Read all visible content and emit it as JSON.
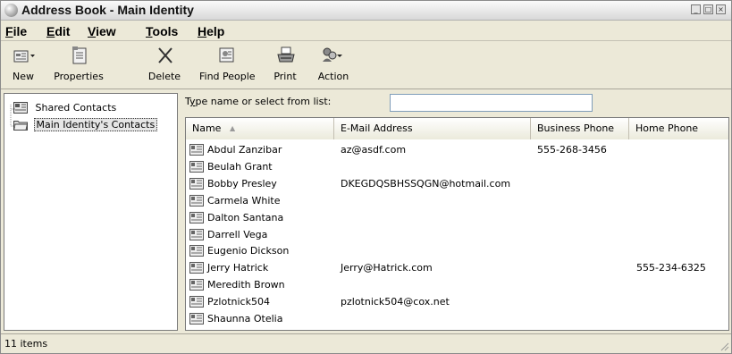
{
  "window": {
    "title": "Address Book - Main Identity"
  },
  "menu": [
    "File",
    "Edit",
    "View",
    "Tools",
    "Help"
  ],
  "toolbar": {
    "new": "New",
    "properties": "Properties",
    "delete": "Delete",
    "find_people": "Find People",
    "print": "Print",
    "action": "Action"
  },
  "tree": {
    "shared": "Shared Contacts",
    "main": "Main Identity's Contacts"
  },
  "search": {
    "label": "Type name or select from list:",
    "value": ""
  },
  "columns": {
    "name": "Name",
    "email": "E-Mail Address",
    "business_phone": "Business Phone",
    "home_phone": "Home Phone"
  },
  "contacts": [
    {
      "name": "Abdul Zanzibar",
      "email": "az@asdf.com",
      "business_phone": "555-268-3456",
      "home_phone": ""
    },
    {
      "name": "Beulah Grant",
      "email": "",
      "business_phone": "",
      "home_phone": ""
    },
    {
      "name": "Bobby Presley",
      "email": "DKEGDQSBHSSQGN@hotmail.com",
      "business_phone": "",
      "home_phone": ""
    },
    {
      "name": "Carmela White",
      "email": "",
      "business_phone": "",
      "home_phone": ""
    },
    {
      "name": "Dalton Santana",
      "email": "",
      "business_phone": "",
      "home_phone": ""
    },
    {
      "name": "Darrell Vega",
      "email": "",
      "business_phone": "",
      "home_phone": ""
    },
    {
      "name": "Eugenio Dickson",
      "email": "",
      "business_phone": "",
      "home_phone": ""
    },
    {
      "name": "Jerry Hatrick",
      "email": "Jerry@Hatrick.com",
      "business_phone": "",
      "home_phone": "555-234-6325"
    },
    {
      "name": "Meredith Brown",
      "email": "",
      "business_phone": "",
      "home_phone": ""
    },
    {
      "name": "Pzlotnick504",
      "email": "pzlotnick504@cox.net",
      "business_phone": "",
      "home_phone": ""
    },
    {
      "name": "Shaunna Otelia",
      "email": "",
      "business_phone": "",
      "home_phone": ""
    }
  ],
  "status": {
    "text": "11 items"
  }
}
